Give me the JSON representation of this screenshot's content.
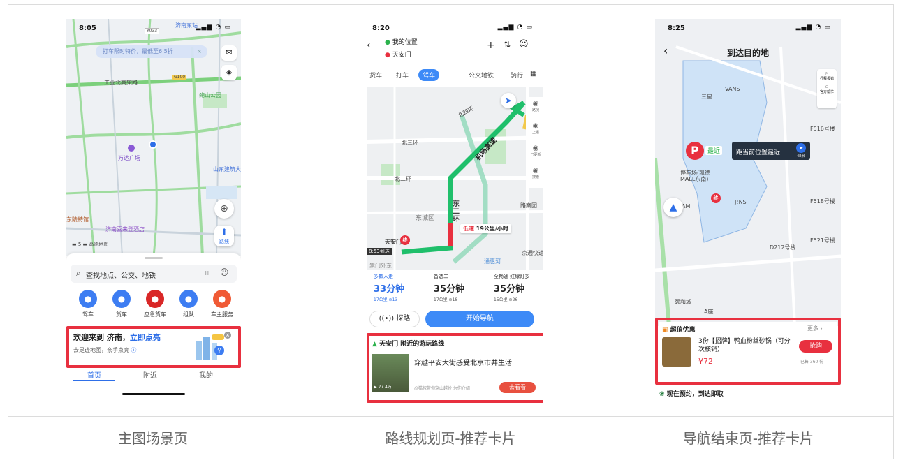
{
  "captions": [
    "主图场景页",
    "路线规划页-推荐卡片",
    "导航结束页-推荐卡片"
  ],
  "p1": {
    "time": "8:05",
    "top_station": "济南东站",
    "road_code": "Y033",
    "promo_bar": "打车限时特价，最低至6.5折",
    "map_labels": {
      "expressway": "工业北高架路",
      "road_g": "G100",
      "park": "鲍山公园",
      "mall": "万达广场",
      "university": "山东建筑大",
      "hospital": "济南喜来登酒店",
      "special": "东陵特馆"
    },
    "scale": "5",
    "map_brand": "高德地图",
    "route_btn": "路线",
    "search_placeholder": "查找地点、公交、地铁",
    "quick_items": [
      {
        "label": "驾车",
        "icon": "car-icon",
        "color": "#3d7df2"
      },
      {
        "label": "货车",
        "icon": "truck-icon",
        "color": "#3d7df2"
      },
      {
        "label": "应急货车",
        "icon": "emergency-truck-icon",
        "color": "#d92727"
      },
      {
        "label": "组队",
        "icon": "team-icon",
        "color": "#3d7df2"
      },
      {
        "label": "车主服务",
        "icon": "car-owner-icon",
        "color": "#f05a35"
      }
    ],
    "card": {
      "title_prefix": "欢迎来到 济南，",
      "title_link": "立即点亮",
      "subtitle": "去足迹地图，亲手点亮"
    },
    "tabs": [
      "首页",
      "附近",
      "我的"
    ]
  },
  "p2": {
    "time": "8:20",
    "origin": "我的位置",
    "destination": "天安门",
    "modes": [
      "货车",
      "打车",
      "驾车",
      "公交地铁",
      "骑行"
    ],
    "map_labels": {
      "north4": "北四环",
      "north3": "北三环",
      "north2": "北二环",
      "dongcheng": "东城区",
      "airport": "机场高速",
      "east_ring": "东二环",
      "speed": "19公里/小时",
      "low": "低速",
      "dest": "天安门",
      "arrive": "8:53到达",
      "jingtong": "京通快速路",
      "tonghui": "通惠河",
      "chongwen": "崇门外东"
    },
    "map_tools": [
      "路况",
      "上报",
      "已更新",
      "搜索"
    ],
    "routes": [
      {
        "tag": "多数人走",
        "time": "33分钟",
        "dist": "17公里 ⊜13",
        "active": true
      },
      {
        "tag": "备选二",
        "time": "35分钟",
        "dist": "17公里 ⊜18",
        "active": false
      },
      {
        "tag": "全畅通 红绿灯多",
        "time": "35分钟",
        "dist": "15公里 ⊜26",
        "active": false
      }
    ],
    "probe_btn": "探路",
    "nav_btn": "开始导航",
    "card": {
      "title": "天安门 附近的游玩路线",
      "text": "穿越平安大街感受北京市井生活",
      "plays": "27.4万",
      "author": "@猫叔带你穿山越岭 为你介绍",
      "btn": "去看看"
    }
  },
  "p3": {
    "time": "8:25",
    "title": "到达目的地",
    "side_tools": [
      "行程报错",
      "官方帮忙"
    ],
    "map_labels": {
      "sanxing": "三星",
      "vans": "VANS",
      "f516": "F516号楼",
      "parking": "停车场(凯德MALL东南)",
      "jins": "J!NS",
      "am": "AM",
      "f518": "F518号楼",
      "d212": "D212号楼",
      "f521": "F521号楼",
      "yihe": "颐和城",
      "a": "A座"
    },
    "nearest_tag": "最近",
    "nearest_tip": "距当前位置最近",
    "nearest_dist": "48米",
    "end_mark": "终",
    "card": {
      "title": "超值优惠",
      "more": "更多",
      "product": "3份【招牌】鸭血粉丝砂锅（可分次核销）",
      "price": "¥72",
      "btn": "抢购",
      "sold": "已售 360 份"
    },
    "bottom": "现在预约，到达即取"
  }
}
